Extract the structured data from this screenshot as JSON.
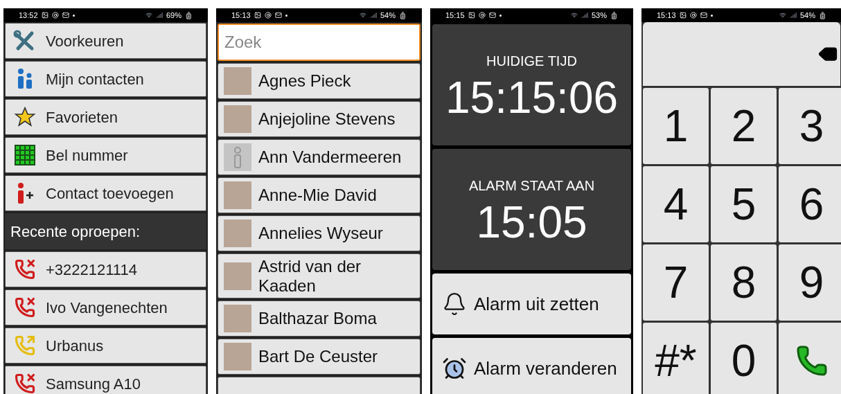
{
  "menu_screen": {
    "status_bar": {
      "time": "13:52",
      "battery": "69%"
    },
    "menu_items": [
      {
        "label": "Voorkeuren"
      },
      {
        "label": "Mijn contacten"
      },
      {
        "label": "Favorieten"
      },
      {
        "label": "Bel nummer"
      },
      {
        "label": "Contact toevoegen"
      }
    ],
    "section_header": "Recente oproepen:",
    "recent_calls": [
      {
        "kind": "missed",
        "label": "+3222121114"
      },
      {
        "kind": "missed",
        "label": "Ivo Vangenechten"
      },
      {
        "kind": "outgoing",
        "label": "Urbanus"
      },
      {
        "kind": "missed",
        "label": "Samsung A10"
      }
    ]
  },
  "contacts_screen": {
    "status_bar": {
      "time": "15:13",
      "battery": "54%"
    },
    "search": {
      "placeholder": "Zoek"
    },
    "contacts": [
      {
        "name": "Agnes Pieck",
        "has_photo": true
      },
      {
        "name": "Anjejoline Stevens",
        "has_photo": true
      },
      {
        "name": "Ann Vandermeeren",
        "has_photo": false
      },
      {
        "name": "Anne-Mie David",
        "has_photo": true
      },
      {
        "name": "Annelies Wyseur",
        "has_photo": true
      },
      {
        "name": "Astrid van der Kaaden",
        "has_photo": true
      },
      {
        "name": "Balthazar Boma",
        "has_photo": true
      },
      {
        "name": "Bart De Ceuster",
        "has_photo": true
      }
    ]
  },
  "alarm_screen": {
    "status_bar": {
      "time": "15:15",
      "battery": "53%"
    },
    "current_time": {
      "label": "HUIDIGE TIJD",
      "time": "15:15:06"
    },
    "alarm": {
      "label": "ALARM STAAT AAN",
      "time": "15:05"
    },
    "buttons": [
      {
        "label": "Alarm uit zetten"
      },
      {
        "label": "Alarm veranderen"
      }
    ]
  },
  "dialer_screen": {
    "status_bar": {
      "time": "15:13",
      "battery": "54%"
    },
    "keys": [
      {
        "kind": "text",
        "label": "1"
      },
      {
        "kind": "text",
        "label": "2"
      },
      {
        "kind": "text",
        "label": "3"
      },
      {
        "kind": "text",
        "label": "4"
      },
      {
        "kind": "text",
        "label": "5"
      },
      {
        "kind": "text",
        "label": "6"
      },
      {
        "kind": "text",
        "label": "7"
      },
      {
        "kind": "text",
        "label": "8"
      },
      {
        "kind": "text",
        "label": "9"
      },
      {
        "kind": "text",
        "label": "#*"
      },
      {
        "kind": "text",
        "label": "0"
      },
      {
        "kind": "call"
      }
    ]
  }
}
